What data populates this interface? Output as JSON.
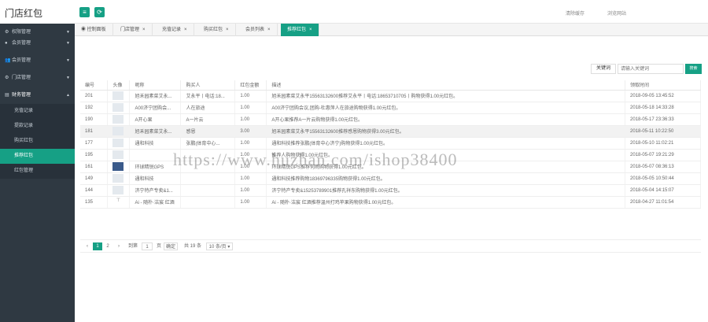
{
  "app": {
    "title": "门店红包"
  },
  "topbar": {
    "menu_icon": "≡",
    "refresh_icon": "⟳",
    "clear_cache": "清除缓存",
    "visit_site": "浏览网站"
  },
  "sidebar": {
    "items": [
      {
        "label": "权限管理",
        "icon": "⚙"
      },
      {
        "label": "会员管理",
        "icon": "●"
      },
      {
        "label": "会员管理",
        "icon": "👥"
      },
      {
        "label": "门店管理",
        "icon": "⚙"
      },
      {
        "label": "财务管理",
        "icon": "▤"
      }
    ],
    "subitems": [
      "充值记录",
      "提款记录",
      "购买红包",
      "推荐红包",
      "红包管理"
    ]
  },
  "tabs": [
    "控制面板",
    "门店管理",
    "充值记录",
    "购买红包",
    "会员列表",
    "推荐红包"
  ],
  "tabs_close": "×",
  "search": {
    "kw_label": "关键词",
    "placeholder": "请输入关键词",
    "button": "搜索"
  },
  "table": {
    "headers": [
      "编号",
      "头像",
      "昵称",
      "购买人",
      "红包金额",
      "描述",
      "领取时间"
    ],
    "rows": [
      {
        "id": "201",
        "nick": "旭禾园素菜艾永...",
        "buyer": "艾永平丨电话:18...",
        "amount": "1.00",
        "desc": "旭禾园素菜艾永平15563132600推荐艾永平丨电话:18653710705丨购物获得1.00元红包。",
        "time": "2018-09-05 13:45:52"
      },
      {
        "id": "192",
        "nick": "A00济宁团购会...",
        "buyer": "人在旅途",
        "amount": "1.00",
        "desc": "A00济宁团购会议,团购-杜惠萍人在旅途购物获得1.00元红包。",
        "time": "2018-05-18 14:33:28"
      },
      {
        "id": "190",
        "nick": "A开心果",
        "buyer": "A一片云",
        "amount": "1.00",
        "desc": "A开心果推荐A一片云购物获得1.00元红包。",
        "time": "2018-05-17 23:36:33"
      },
      {
        "id": "181",
        "nick": "旭禾园素菜艾永...",
        "buyer": "感恩",
        "amount": "3.00",
        "desc": "旭禾园素菜艾永平15563132600推荐感恩购物获得3.00元红包。",
        "time": "2018-05-11 10:22:50"
      },
      {
        "id": "177",
        "nick": "通和科技",
        "buyer": "张鹏(体育中心...",
        "amount": "1.00",
        "desc": "通和科技推荐张鹏(体育中心济宁)购物获得1.00元红包。",
        "time": "2018-05-10 11:02:21"
      },
      {
        "id": "195",
        "nick": "",
        "buyer": "",
        "amount": "1.00",
        "desc": "推荐人购物获得1.00元红包。",
        "time": "2018-05-07 19:21:29"
      },
      {
        "id": "161",
        "nick": "环球精锐GPS",
        "buyer": "",
        "amount": "1.00",
        "desc": "环球精锐GPS推荐何雨购物获得1.00元红包。",
        "time": "2018-05-07 08:36:13"
      },
      {
        "id": "149",
        "nick": "通和科技",
        "buyer": "",
        "amount": "1.00",
        "desc": "通和科技推荐购物18369796335购物获得1.00元红包。",
        "time": "2018-05-05 10:50:44"
      },
      {
        "id": "144",
        "nick": "济宁特产专卖&1...",
        "buyer": "",
        "amount": "1.00",
        "desc": "济宁特产专卖&15253789901推荐孔祥东购物获得1.00元红包。",
        "time": "2018-05-04 14:15:07"
      },
      {
        "id": "135",
        "nick": "Ai - 随朴·洁宸 红酒",
        "buyer": "",
        "amount": "1.00",
        "desc": "Ai - 随朴·洁宸 红酒推荐温州打鸡苹果购物获得1.00元红包。",
        "time": "2018-04-27 11:01:54"
      }
    ]
  },
  "pager": {
    "prev": "‹",
    "p1": "1",
    "p2": "2",
    "next": "›",
    "goto": "到第",
    "page_input": "1",
    "page_unit": "页",
    "confirm": "确定",
    "total": "共 19 条",
    "per_page": "10 条/页"
  },
  "watermark": "https://www.huzhan.com/ishop38400",
  "colors": {
    "accent": "#16a085",
    "sidebar": "#2f3942"
  }
}
